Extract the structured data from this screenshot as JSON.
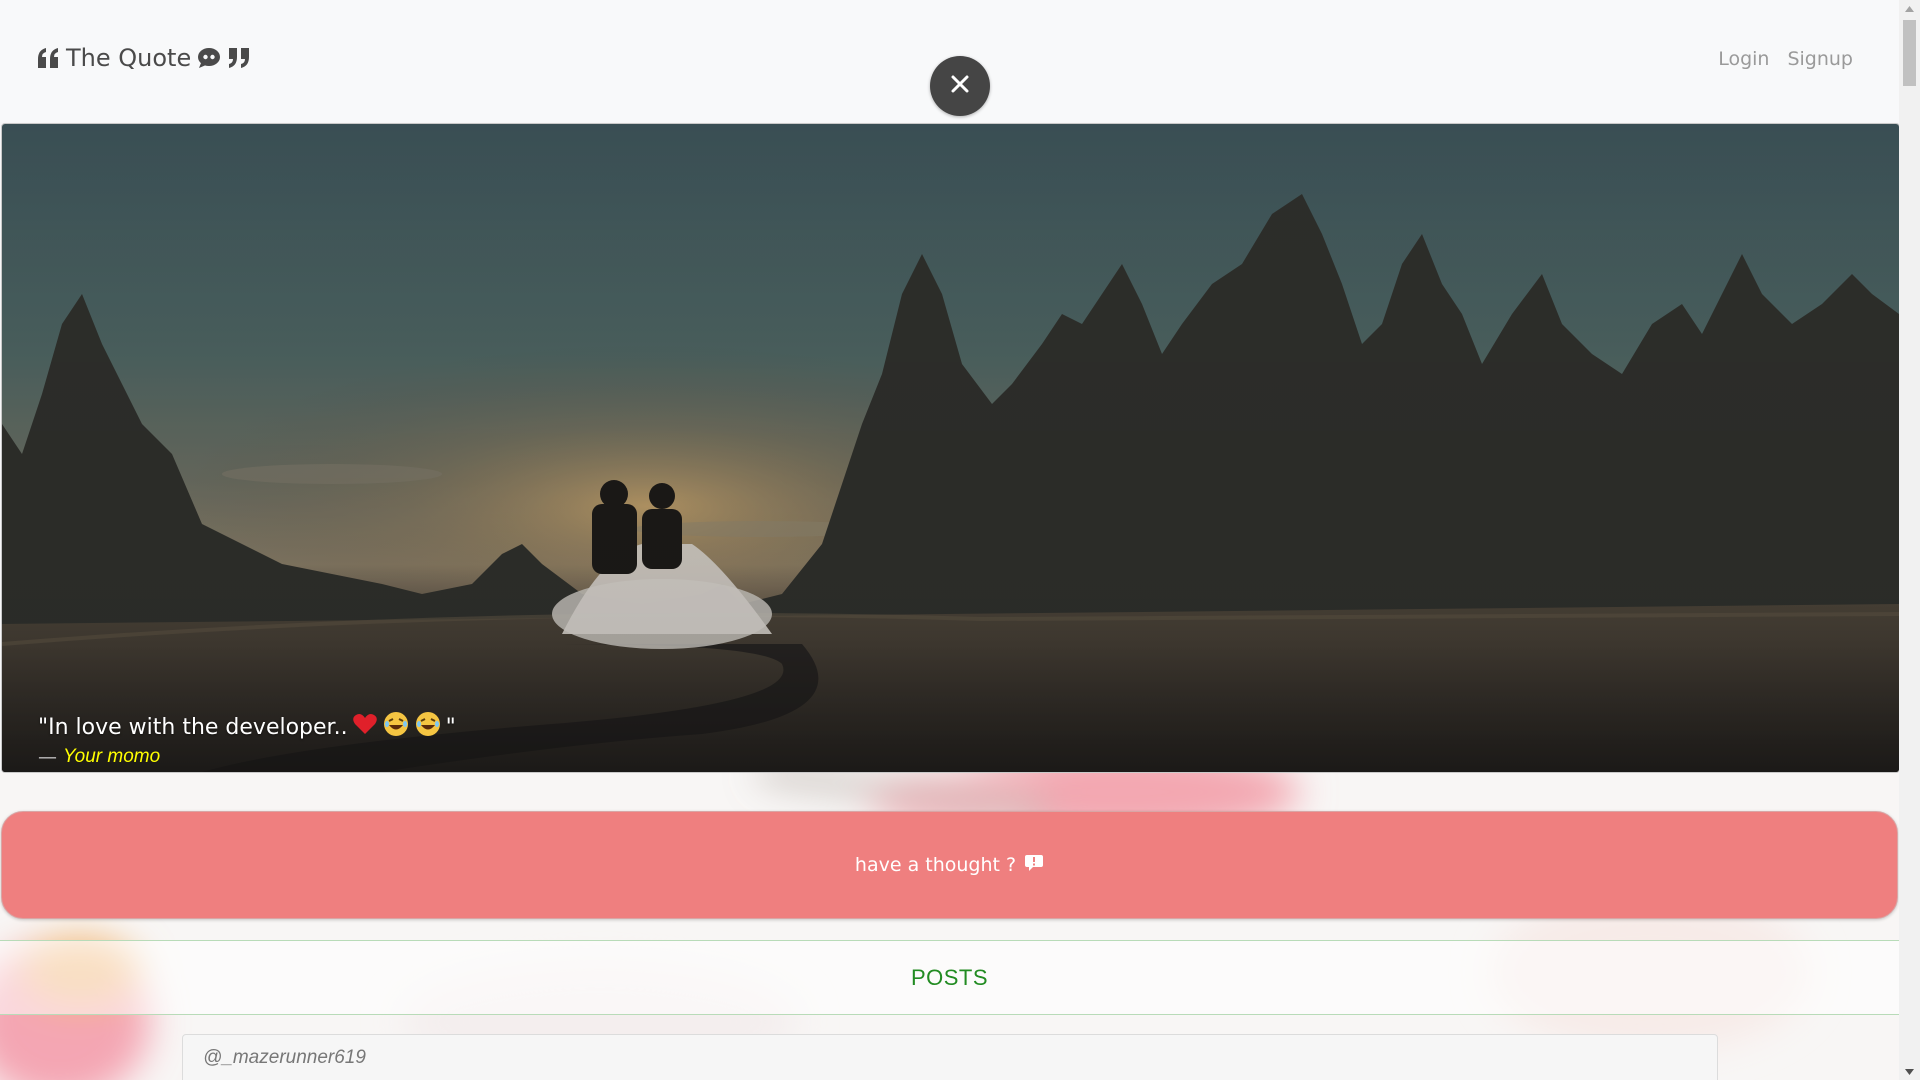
{
  "navbar": {
    "brand": "The Quote",
    "links": [
      "Login",
      "Signup"
    ]
  },
  "hero": {
    "quote": "\"In love with the developer..",
    "quote_end": "\"",
    "emojis": [
      "heart-emoji",
      "laughing-emoji",
      "laughing-emoji"
    ],
    "author_dash": "—",
    "author": "Your momo"
  },
  "thought_button": {
    "label": "have a thought ?"
  },
  "posts": {
    "heading": "POSTS",
    "first_user": "@_mazerunner619"
  },
  "colors": {
    "thought_button": "#ef7f7f",
    "posts_heading": "#228b22",
    "author_name": "#ffff00",
    "close_button": "#454545"
  }
}
